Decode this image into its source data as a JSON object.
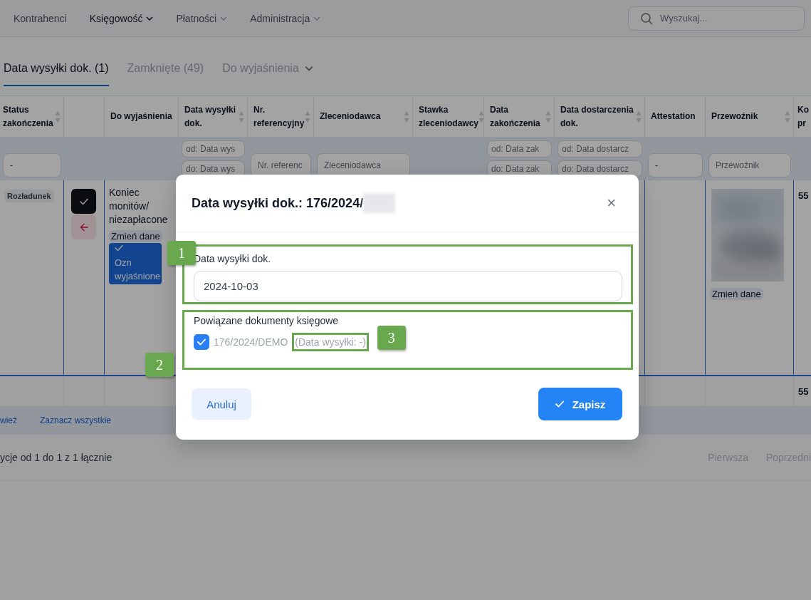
{
  "nav": {
    "items": [
      {
        "label": "Kontrahenci",
        "selected": false,
        "dropdown": false
      },
      {
        "label": "Księgowość",
        "selected": true,
        "dropdown": true
      },
      {
        "label": "Płatności",
        "selected": false,
        "dropdown": true
      },
      {
        "label": "Administracja",
        "selected": false,
        "dropdown": true
      }
    ],
    "search": {
      "placeholder": "Wyszukaj..."
    }
  },
  "tabs": [
    {
      "label": "Data wysyłki dok. (1)",
      "selected": true,
      "dropdown": false
    },
    {
      "label": "Zamknięte (49)",
      "selected": false,
      "dropdown": false
    },
    {
      "label": "Do wyjaśnienia",
      "selected": false,
      "dropdown": true
    }
  ],
  "table": {
    "columns": [
      {
        "label": "Status zakończenia",
        "sortable": true,
        "filters": [
          {
            "kind": "select",
            "value": "-"
          }
        ]
      },
      {
        "sortable": false
      },
      {
        "label": "Do wyjaśnienia",
        "sortable": false
      },
      {
        "label": "Data wysyłki dok.",
        "sortable": true,
        "filters": [
          {
            "kind": "input",
            "placeholder": "od: Data wys"
          },
          {
            "kind": "input",
            "placeholder": "do: Data wys"
          }
        ]
      },
      {
        "label": "Nr. referencyjny",
        "sortable": true,
        "filters": [
          {
            "kind": "input",
            "placeholder": "Nr. referenc"
          }
        ]
      },
      {
        "label": "Zleceniodawca",
        "sortable": true,
        "filters": [
          {
            "kind": "input",
            "placeholder": "Zleceniodawca"
          }
        ]
      },
      {
        "label": "Stawka zleceniodawcy",
        "sortable": true
      },
      {
        "label": "Data zakończenia",
        "sortable": true,
        "filters": [
          {
            "kind": "input",
            "placeholder": "od: Data zak"
          },
          {
            "kind": "input",
            "placeholder": "do: Data zak"
          }
        ]
      },
      {
        "label": "Data dostarczenia dok.",
        "sortable": true,
        "filters": [
          {
            "kind": "input",
            "placeholder": "od: Data dostarcz"
          },
          {
            "kind": "input",
            "placeholder": "do: Data dostarcz"
          }
        ]
      },
      {
        "label": "Attestation",
        "sortable": false,
        "filters": [
          {
            "kind": "select",
            "value": "-"
          }
        ]
      },
      {
        "label": "Przewoźnik",
        "sortable": true,
        "filters": [
          {
            "kind": "input",
            "placeholder": "Przewoźnik"
          }
        ]
      },
      {
        "label": "Ko pr",
        "sortable": false
      }
    ],
    "rows": [
      {
        "selected": true,
        "status_tag": "Rozładunek",
        "actions": [
          {
            "kind": "confirm"
          },
          {
            "kind": "back"
          }
        ],
        "note": "Koniec monitów/ niezapłacone",
        "note_edit": "Zmień dane",
        "resolve_button": "Ozn wyjaśnione",
        "carrier": {
          "kind": "picture",
          "edit": "Zmień dane"
        },
        "column_12": "55"
      }
    ],
    "totals": {
      "column_12": "55"
    }
  },
  "action_bar": [
    "wież",
    "Zaznacz wszystkie"
  ],
  "pagination": {
    "summary": "ycje od 1 do 1 z 1 łącznie",
    "links": [
      {
        "label": "Pierwsza",
        "disabled": true
      },
      {
        "label": "Poprzedni",
        "disabled": true
      }
    ]
  },
  "modal": {
    "title": "Data wysyłki dok.: 176/2024/",
    "title_redacted": true,
    "field": {
      "label": "Data wysyłki dok.",
      "value": "2024-10-03",
      "callout": "1"
    },
    "related": {
      "label": "Powiązane dokumenty księgowe",
      "callout": "2",
      "items": [
        {
          "number": "176/2024/DEMO",
          "note": "(Data wysyłki: -)",
          "checked": true,
          "note_callout": "3"
        }
      ]
    },
    "close": "×",
    "cancel": "Anuluj",
    "save": "Zapisz"
  }
}
